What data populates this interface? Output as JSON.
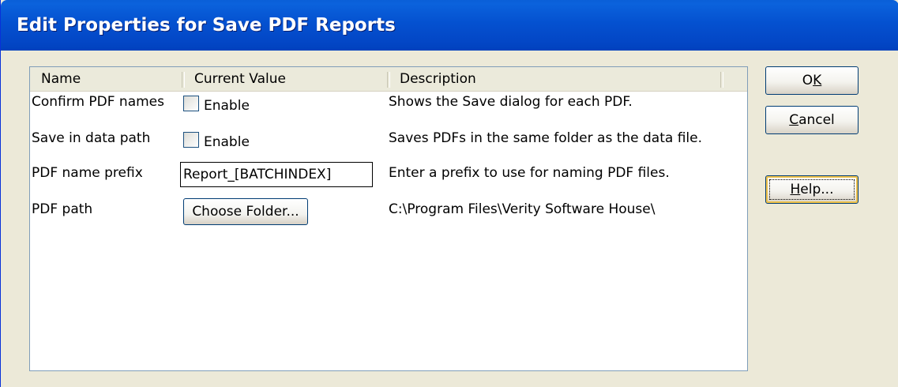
{
  "window": {
    "title": "Edit Properties for Save PDF Reports"
  },
  "table": {
    "columns": [
      "Name",
      "Current Value",
      "Description"
    ],
    "rows": [
      {
        "name": "Confirm PDF names",
        "control": "checkbox",
        "value": "Enable",
        "checked": false,
        "description": "Shows the Save dialog for each PDF."
      },
      {
        "name": "Save in data path",
        "control": "checkbox",
        "value": "Enable",
        "checked": false,
        "description": "Saves PDFs in the same folder as the data file."
      },
      {
        "name": "PDF name prefix",
        "control": "textbox",
        "value": "Report_[BATCHINDEX]",
        "description": "Enter a prefix to use for naming PDF files."
      },
      {
        "name": "PDF path",
        "control": "button",
        "value": "Choose Folder...",
        "description": "C:\\Program Files\\Verity Software House\\"
      }
    ]
  },
  "buttons": {
    "ok": {
      "label": "OK",
      "mnemonic": "K"
    },
    "cancel": {
      "label": "Cancel",
      "mnemonic": "C"
    },
    "help": {
      "label": "Help...",
      "mnemonic": "H"
    }
  },
  "colors": {
    "titlebar": "#0451d0",
    "dialog_bg": "#ece9d8",
    "list_border": "#7f9db9",
    "button_border": "#003c74"
  }
}
